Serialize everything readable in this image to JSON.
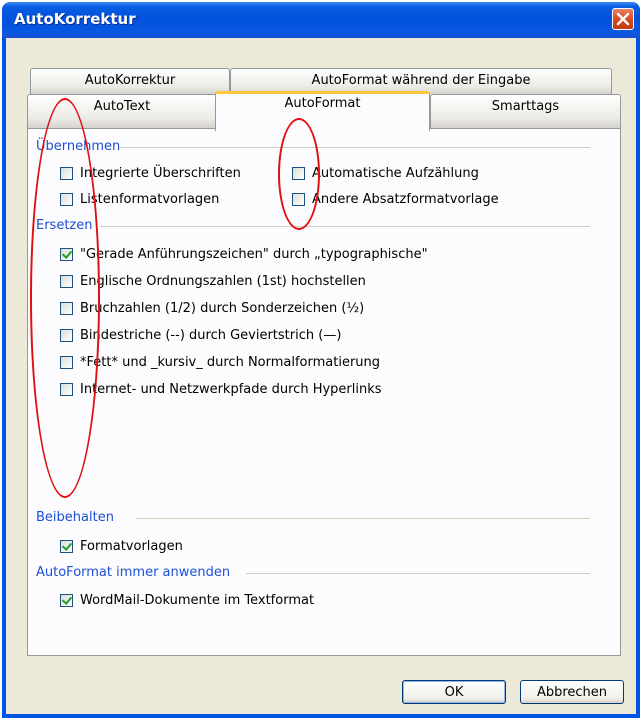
{
  "window": {
    "title": "AutoKorrektur"
  },
  "tabs_back": [
    {
      "label": "AutoKorrektur"
    },
    {
      "label": "AutoFormat während der Eingabe"
    }
  ],
  "tabs_front": [
    {
      "label": "AutoText"
    },
    {
      "label": "AutoFormat"
    },
    {
      "label": "Smarttags"
    }
  ],
  "groups": {
    "uebernehmen": {
      "title": "Übernehmen",
      "options": [
        {
          "label": "Integrierte Überschriften",
          "checked": false
        },
        {
          "label": "Automatische Aufzählung",
          "checked": false
        },
        {
          "label": "Listenformatvorlagen",
          "checked": false
        },
        {
          "label": "Andere Absatzformatvorlage",
          "checked": false
        }
      ]
    },
    "ersetzen": {
      "title": "Ersetzen",
      "options": [
        {
          "label": "\"Gerade Anführungszeichen\" durch „typographische\"",
          "checked": true
        },
        {
          "label": "Englische Ordnungszahlen (1st) hochstellen",
          "checked": false
        },
        {
          "label": "Bruchzahlen (1/2) durch Sonderzeichen (½)",
          "checked": false
        },
        {
          "label": "Bindestriche (--) durch Geviertstrich (—)",
          "checked": false
        },
        {
          "label": "*Fett* und _kursiv_ durch Normalformatierung",
          "checked": false
        },
        {
          "label": "Internet- und Netzwerkpfade durch Hyperlinks",
          "checked": false
        }
      ]
    },
    "beibehalten": {
      "title": "Beibehalten",
      "options": [
        {
          "label": "Formatvorlagen",
          "checked": true
        }
      ]
    },
    "immer": {
      "title": "AutoFormat immer anwenden",
      "options": [
        {
          "label": "WordMail-Dokumente im Textformat",
          "checked": true
        }
      ]
    }
  },
  "buttons": {
    "ok": "OK",
    "cancel": "Abbrechen"
  },
  "colors": {
    "titlebar": "#0054e3",
    "group_title": "#1c50d4",
    "annotation": "#e01010",
    "check": "#21a121"
  },
  "icons": {
    "close": "close-icon",
    "check": "check-icon"
  }
}
